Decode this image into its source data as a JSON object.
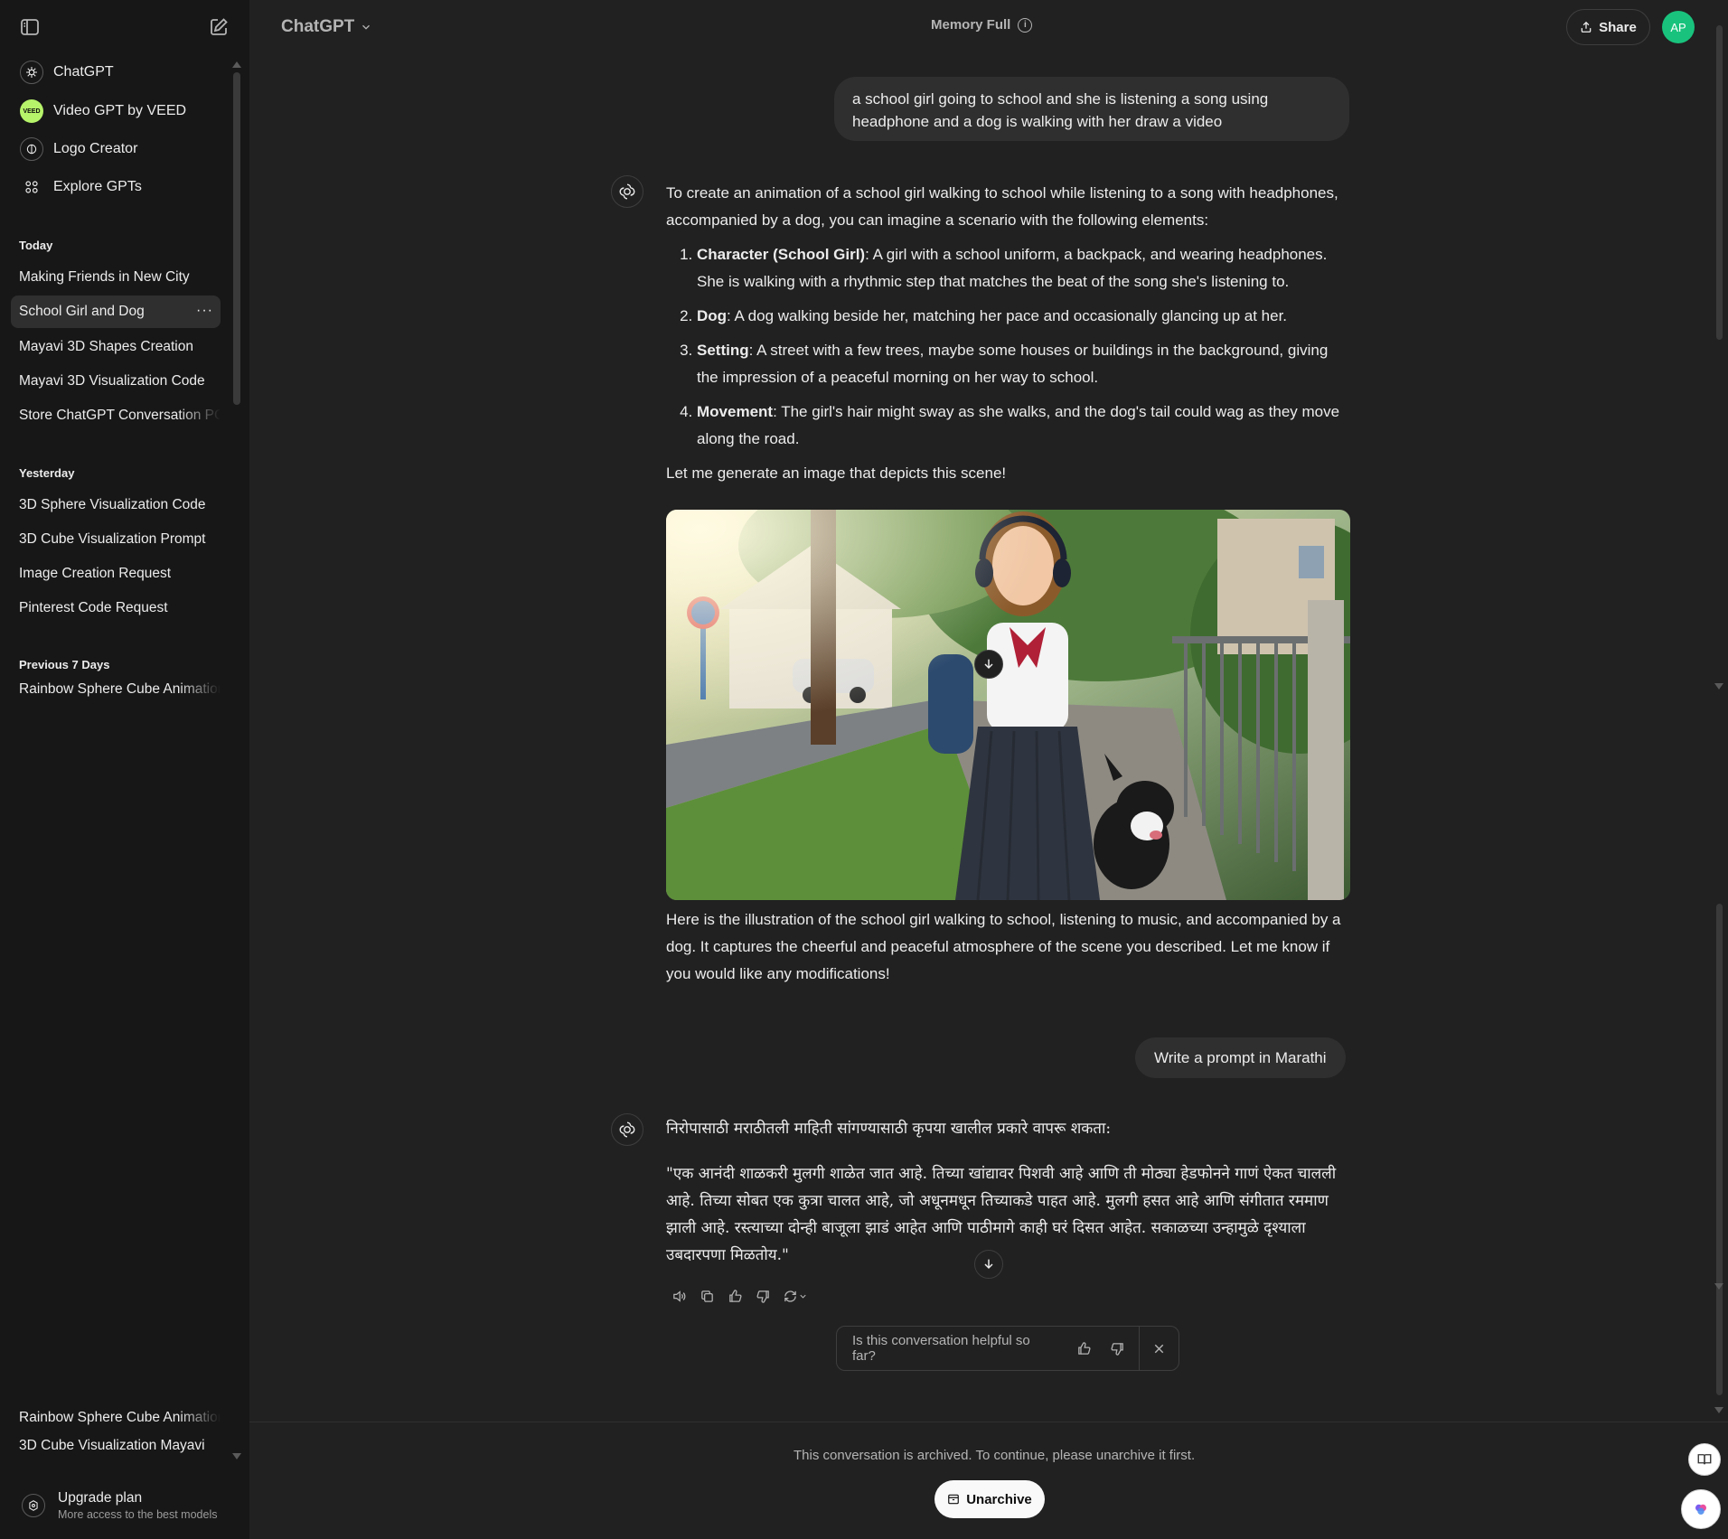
{
  "sidebar": {
    "gpts": [
      {
        "label": "ChatGPT",
        "icon": "chatgpt-logo-icon"
      },
      {
        "label": "Video GPT by VEED",
        "icon": "veed-logo-icon",
        "badge": "VEED"
      },
      {
        "label": "Logo Creator",
        "icon": "logo-creator-icon"
      },
      {
        "label": "Explore GPTs",
        "icon": "grid-icon"
      }
    ],
    "sections": {
      "today": "Today",
      "yesterday": "Yesterday",
      "previous7": "Previous 7 Days"
    },
    "today_chats": [
      "Making Friends in New City",
      "School Girl and Dog",
      "Mayavi 3D Shapes Creation",
      "Mayavi 3D Visualization Code",
      "Store ChatGPT Conversation PC"
    ],
    "yesterday_chats": [
      "3D Sphere Visualization Code",
      "3D Cube Visualization Prompt",
      "Image Creation Request",
      "Pinterest Code Request"
    ],
    "previous7_chats": [
      "Rainbow Sphere Cube Animation",
      "3D Cube Visualization Mayavi"
    ],
    "more_label": "···",
    "upgrade": {
      "title": "Upgrade plan",
      "subtitle": "More access to the best models"
    }
  },
  "header": {
    "model": "ChatGPT",
    "memory": "Memory Full",
    "share": "Share",
    "avatar_initials": "AP",
    "avatar_color": "#19c37d"
  },
  "conversation": {
    "user_msg_1": "a school girl going to school and she is listening a song using headphone and a dog is walking with her draw a video",
    "assistant_1": {
      "intro": "To create an animation of a school girl walking to school while listening to a song with headphones, accompanied by a dog, you can imagine a scenario with the following elements:",
      "items": [
        {
          "term": "Character (School Girl)",
          "text": ": A girl with a school uniform, a backpack, and wearing headphones. She is walking with a rhythmic step that matches the beat of the song she's listening to."
        },
        {
          "term": "Dog",
          "text": ": A dog walking beside her, matching her pace and occasionally glancing up at her."
        },
        {
          "term": "Setting",
          "text": ": A street with a few trees, maybe some houses or buildings in the background, giving the impression of a peaceful morning on her way to school."
        },
        {
          "term": "Movement",
          "text": ": The girl's hair might sway as she walks, and the dog's tail could wag as they move along the road."
        }
      ],
      "outro": "Let me generate an image that depicts this scene!",
      "after_image": "Here is the illustration of the school girl walking to school, listening to music, and accompanied by a dog. It captures the cheerful and peaceful atmosphere of the scene you described. Let me know if you would like any modifications!"
    },
    "user_msg_2": "Write a prompt in Marathi",
    "assistant_2": {
      "intro": "निरोपासाठी मराठीतली माहिती सांगण्यासाठी कृपया खालील प्रकारे वापरू शकता:",
      "quote": "\"एक आनंदी शाळकरी मुलगी शाळेत जात आहे. तिच्या खांद्यावर पिशवी आहे आणि ती मोठ्या हेडफोनने गाणं ऐकत चालली आहे. तिच्या सोबत एक कुत्रा चालत आहे, जो अधूनमधून तिच्याकडे पाहत आहे. मुलगी हसत आहे आणि संगीतात रममाण झाली आहे. रस्त्याच्या दोन्ही बाजूला झाडं आहेत आणि पाठीमागे काही घरं दिसत आहेत. सकाळच्या उन्हामुळे दृश्याला उबदारपणा मिळतोय.\""
    },
    "feedback_question": "Is this conversation helpful so far?"
  },
  "footer": {
    "archived_notice": "This conversation is archived. To continue, please unarchive it first.",
    "unarchive": "Unarchive"
  }
}
